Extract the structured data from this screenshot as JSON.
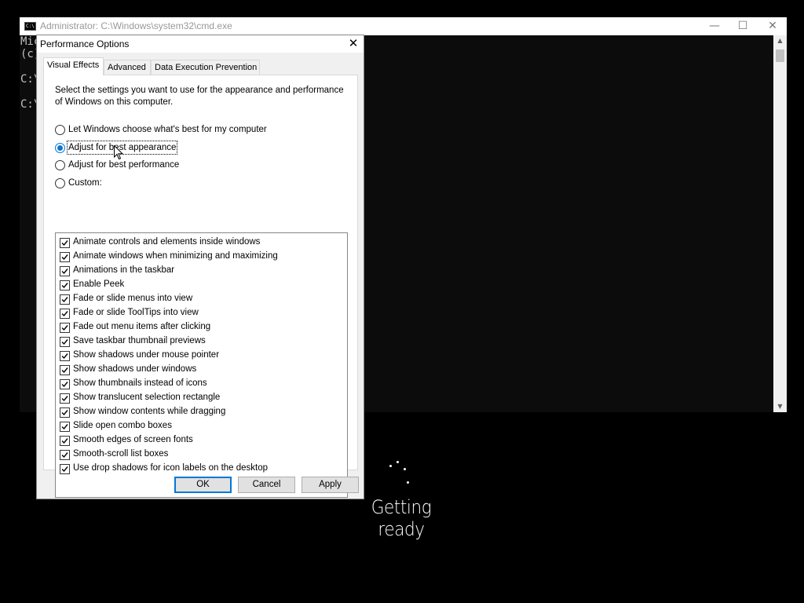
{
  "cmd": {
    "title": "Administrator: C:\\Windows\\system32\\cmd.exe",
    "icon_text": "C:\\",
    "lines": [
      "Mic",
      "(c)",
      "",
      "C:\\",
      "",
      "C:\\"
    ],
    "min": "—",
    "max": "☐",
    "close": "✕"
  },
  "dialog": {
    "title": "Performance Options",
    "close": "✕",
    "tabs": [
      "Visual Effects",
      "Advanced",
      "Data Execution Prevention"
    ],
    "active_tab": "Visual Effects",
    "description": "Select the settings you want to use for the appearance and performance of Windows on this computer.",
    "options": [
      {
        "label": "Let Windows choose what's best for my computer",
        "checked": false
      },
      {
        "label": "Adjust for best appearance",
        "checked": true
      },
      {
        "label": "Adjust for best performance",
        "checked": false
      },
      {
        "label": "Custom:",
        "checked": false
      }
    ],
    "effects": [
      {
        "label": "Animate controls and elements inside windows",
        "checked": true
      },
      {
        "label": "Animate windows when minimizing and maximizing",
        "checked": true
      },
      {
        "label": "Animations in the taskbar",
        "checked": true
      },
      {
        "label": "Enable Peek",
        "checked": true
      },
      {
        "label": "Fade or slide menus into view",
        "checked": true
      },
      {
        "label": "Fade or slide ToolTips into view",
        "checked": true
      },
      {
        "label": "Fade out menu items after clicking",
        "checked": true
      },
      {
        "label": "Save taskbar thumbnail previews",
        "checked": true
      },
      {
        "label": "Show shadows under mouse pointer",
        "checked": true
      },
      {
        "label": "Show shadows under windows",
        "checked": true
      },
      {
        "label": "Show thumbnails instead of icons",
        "checked": true
      },
      {
        "label": "Show translucent selection rectangle",
        "checked": true
      },
      {
        "label": "Show window contents while dragging",
        "checked": true
      },
      {
        "label": "Slide open combo boxes",
        "checked": true
      },
      {
        "label": "Smooth edges of screen fonts",
        "checked": true
      },
      {
        "label": "Smooth-scroll list boxes",
        "checked": true
      },
      {
        "label": "Use drop shadows for icon labels on the desktop",
        "checked": true
      }
    ],
    "buttons": {
      "ok": "OK",
      "cancel": "Cancel",
      "apply": "Apply"
    }
  },
  "status": {
    "text": "Getting ready"
  }
}
